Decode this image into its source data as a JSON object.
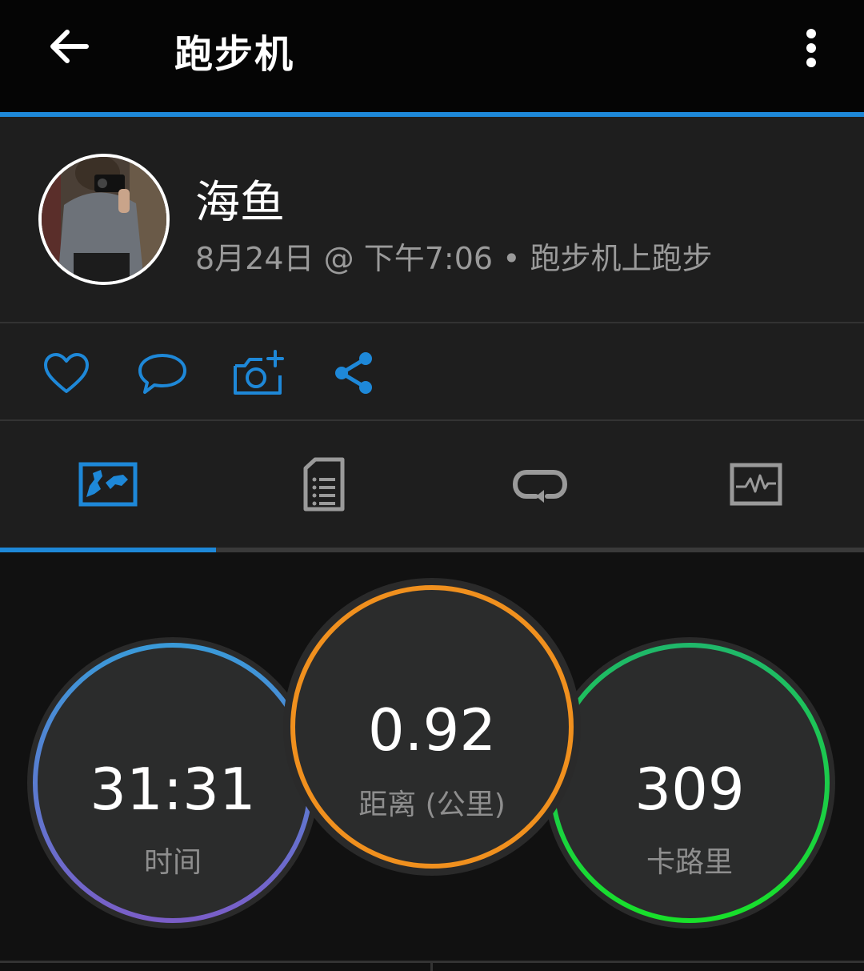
{
  "header": {
    "title": "跑步机"
  },
  "activity": {
    "user_name": "海鱼",
    "date": "8月24日",
    "at": "@",
    "time": "下午7:06",
    "separator": "•",
    "activity_type": "跑步机上跑步"
  },
  "stats": {
    "time": {
      "value": "31:31",
      "label": "时间"
    },
    "distance": {
      "value": "0.92",
      "label": "距离 (公里)"
    },
    "calories": {
      "value": "309",
      "label": "卡路里"
    }
  },
  "tabs": {
    "selected_index": 0,
    "items": [
      "overview-tab",
      "details-tab",
      "laps-tab",
      "charts-tab"
    ]
  },
  "colors": {
    "accent": "#1e88d8",
    "time_ring": [
      "#3a9ad9",
      "#7a5ec8"
    ],
    "distance_ring": "#f0901e",
    "calories_ring": [
      "#1fb86a",
      "#18e02a"
    ]
  }
}
